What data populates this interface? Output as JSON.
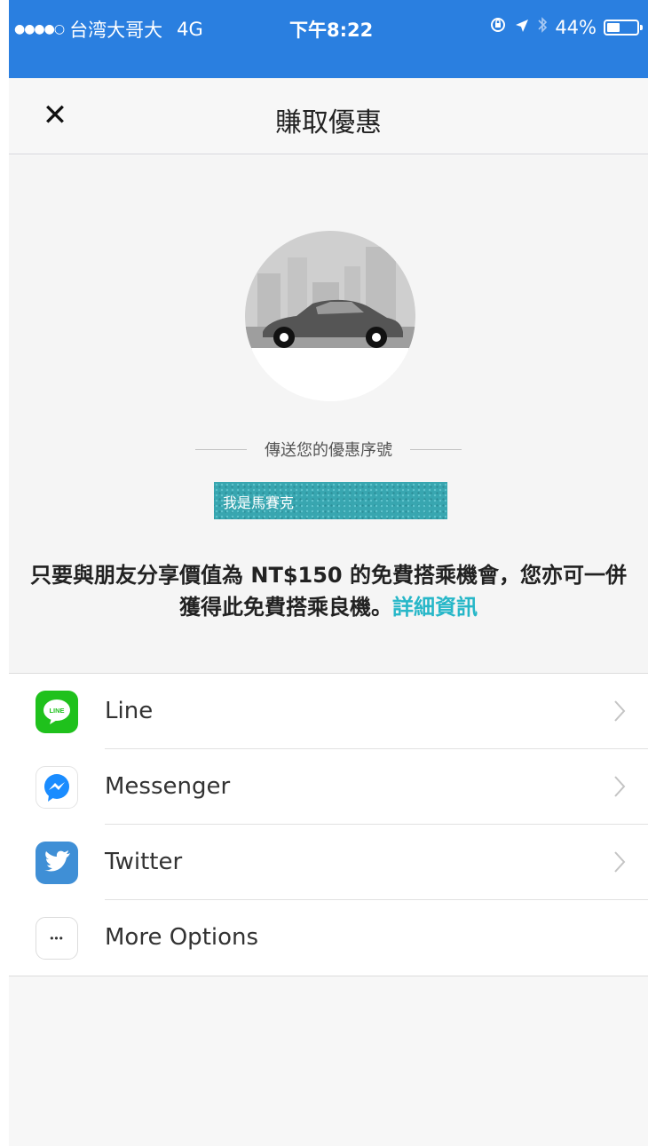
{
  "status_bar": {
    "signal": "●●●●○",
    "carrier": "台湾大哥大",
    "network": "4G",
    "time": "下午8:22",
    "battery_text": "44%",
    "battery_level": 0.44,
    "background_color": "#2a7fe0"
  },
  "nav": {
    "close_label": "✕",
    "title": "賺取優惠"
  },
  "hero": {
    "code_heading": "傳送您的優惠序號",
    "promo_code_partial": "u          n",
    "mask_label": "我是馬賽克",
    "description_text": "只要與朋友分享價值為 NT$150 的免費搭乘機會，您亦可一併獲得此免費搭乘良機。",
    "description_link": "詳細資訊",
    "accent_color": "#27b7c8"
  },
  "share_options": [
    {
      "label": "Line",
      "icon": "line-icon",
      "icon_text": "LINE",
      "color": "#1fc11c",
      "chevron": true
    },
    {
      "label": "Messenger",
      "icon": "messenger-icon",
      "color": "#1a8cff",
      "chevron": true
    },
    {
      "label": "Twitter",
      "icon": "twitter-icon",
      "color": "#3f8fd6",
      "chevron": true
    },
    {
      "label": "More Options",
      "icon": "more-options-icon",
      "icon_text": "•••",
      "chevron": false
    }
  ]
}
